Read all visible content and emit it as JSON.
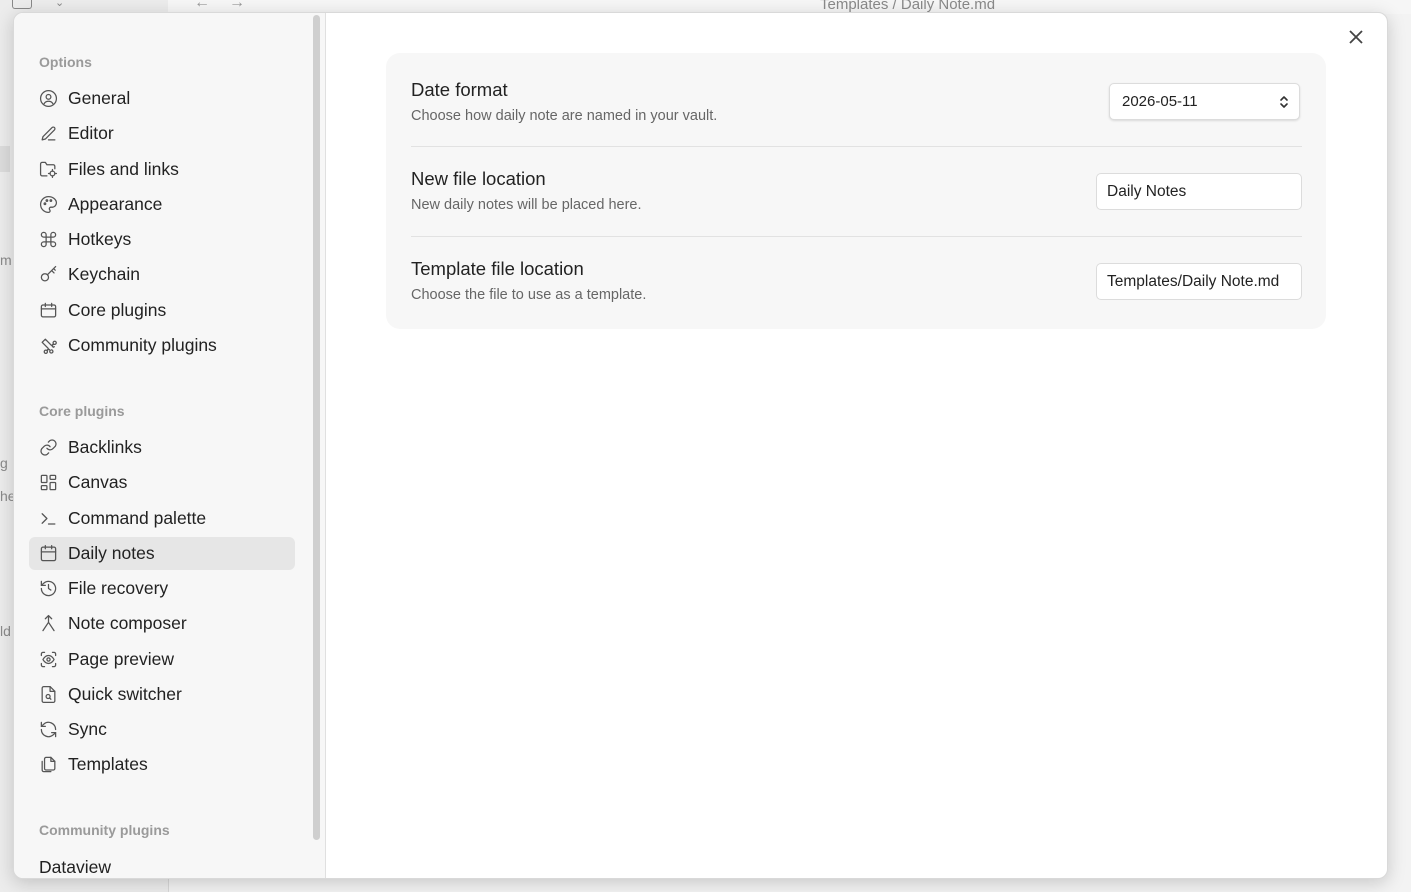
{
  "background": {
    "breadcrumb": "Templates / Daily Note.md",
    "back_arrow": "←",
    "forward_arrow": "→",
    "left_fragments": [
      "m",
      "g",
      "he",
      "ld"
    ]
  },
  "sidebar": {
    "options_title": "Options",
    "options": [
      {
        "label": "General",
        "icon": "user-circle-icon"
      },
      {
        "label": "Editor",
        "icon": "pencil-icon"
      },
      {
        "label": "Files and links",
        "icon": "folder-cog-icon"
      },
      {
        "label": "Appearance",
        "icon": "palette-icon"
      },
      {
        "label": "Hotkeys",
        "icon": "command-icon"
      },
      {
        "label": "Keychain",
        "icon": "key-icon"
      },
      {
        "label": "Core plugins",
        "icon": "calendar-box-icon"
      },
      {
        "label": "Community plugins",
        "icon": "puzzle-icon"
      }
    ],
    "core_title": "Core plugins",
    "core": [
      {
        "label": "Backlinks",
        "icon": "link-icon"
      },
      {
        "label": "Canvas",
        "icon": "layout-icon"
      },
      {
        "label": "Command palette",
        "icon": "terminal-icon"
      },
      {
        "label": "Daily notes",
        "icon": "calendar-icon",
        "active": true
      },
      {
        "label": "File recovery",
        "icon": "history-icon"
      },
      {
        "label": "Note composer",
        "icon": "merge-icon"
      },
      {
        "label": "Page preview",
        "icon": "scan-eye-icon"
      },
      {
        "label": "Quick switcher",
        "icon": "file-search-icon"
      },
      {
        "label": "Sync",
        "icon": "sync-icon"
      },
      {
        "label": "Templates",
        "icon": "files-icon"
      }
    ],
    "community_title": "Community plugins",
    "community": [
      {
        "label": "Dataview"
      }
    ]
  },
  "settings": {
    "date_format": {
      "name": "Date format",
      "desc": "Choose how daily note are named in your vault.",
      "value": "2026-05-11"
    },
    "new_file_location": {
      "name": "New file location",
      "desc": "New daily notes will be placed here.",
      "value": "Daily Notes"
    },
    "template_file_location": {
      "name": "Template file location",
      "desc": "Choose the file to use as a template.",
      "value": "Templates/Daily Note.md"
    }
  }
}
